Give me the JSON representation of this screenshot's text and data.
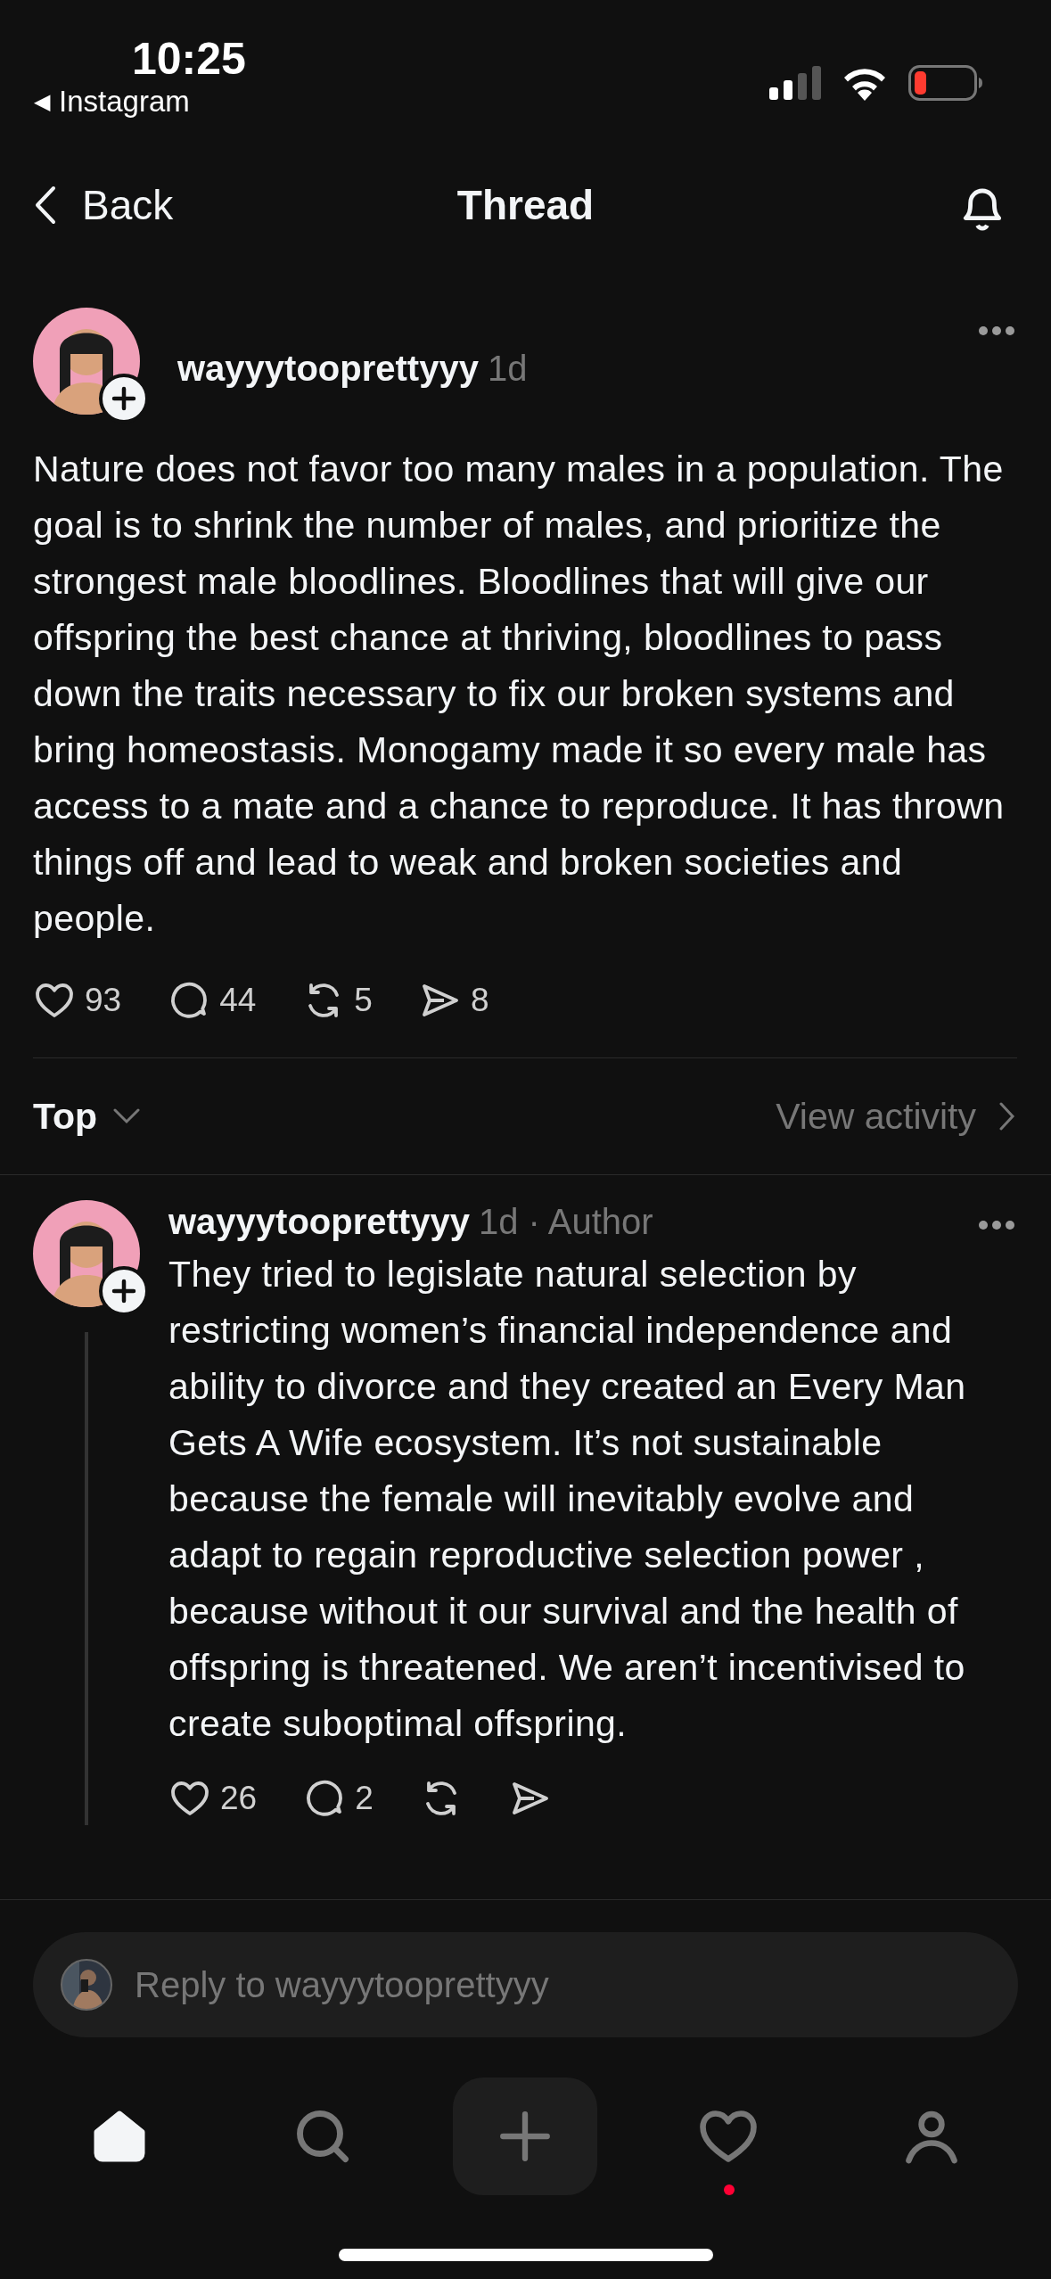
{
  "status_bar": {
    "time": "10:25",
    "back_arrow": "◀",
    "back_app": "Instagram"
  },
  "header": {
    "back": "Back",
    "title": "Thread"
  },
  "post": {
    "username": "wayyytooprettyyy",
    "meta": "1d",
    "text": "Nature does not favor too many males in a population. The goal is to shrink the number of males, and prioritize the strongest male bloodlines. Bloodlines that will give our offspring the best chance at thriving, bloodlines to pass down the traits necessary to fix our broken systems and bring homeostasis. Monogamy made it so every male has access to a mate and a chance to reproduce. It has thrown things off and lead to weak and broken societies and people.",
    "actions": [
      {
        "kind": "like",
        "count": "93"
      },
      {
        "kind": "comment",
        "count": "44"
      },
      {
        "kind": "repost",
        "count": "5"
      },
      {
        "kind": "share",
        "count": "8"
      }
    ]
  },
  "sort": {
    "label": "Top",
    "view_activity": "View activity"
  },
  "replies": [
    {
      "username": "wayyytooprettyyy",
      "meta": "1d · Author",
      "text": "They tried to legislate natural selection by restricting women’s financial independence and ability to divorce and they created an Every Man Gets A Wife ecosystem. It’s not sustainable because the female will inevitably evolve and adapt to regain reproductive selection power , because without it our survival and the health of offspring is threatened. We aren’t incentivised to create suboptimal offspring.",
      "actions": [
        {
          "kind": "like",
          "count": "26"
        },
        {
          "kind": "comment",
          "count": "2"
        },
        {
          "kind": "repost"
        },
        {
          "kind": "share"
        }
      ]
    }
  ],
  "reply_field": {
    "placeholder": "Reply to wayyytooprettyyy"
  },
  "tab_bar": [
    {
      "kind": "home",
      "selected": true,
      "badge": false
    },
    {
      "kind": "search",
      "selected": false,
      "badge": false
    },
    {
      "kind": "create",
      "selected": false,
      "badge": false
    },
    {
      "kind": "activity",
      "selected": false,
      "badge": true
    },
    {
      "kind": "profile",
      "selected": false,
      "badge": false
    }
  ]
}
